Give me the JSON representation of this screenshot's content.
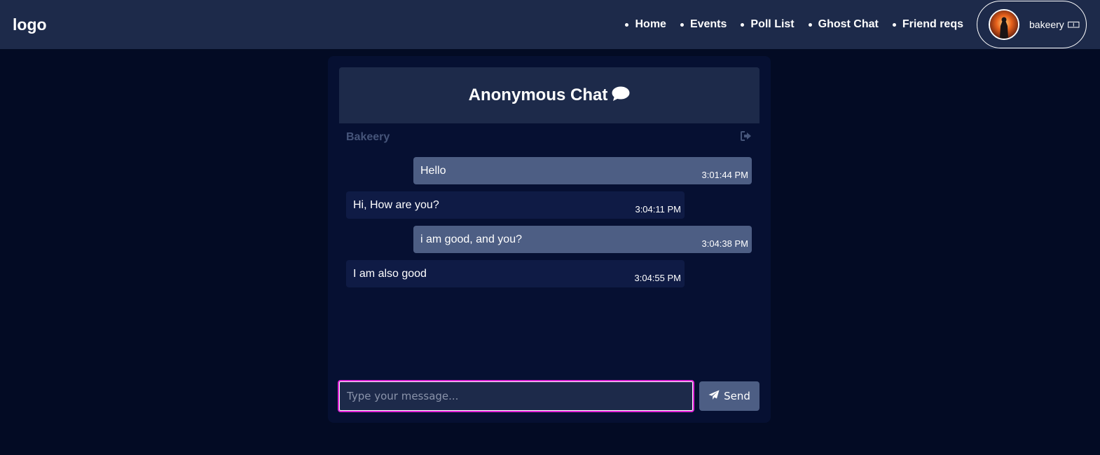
{
  "header": {
    "logo": "logo",
    "nav": [
      {
        "label": "Home"
      },
      {
        "label": "Events"
      },
      {
        "label": "Poll List"
      },
      {
        "label": "Ghost Chat"
      },
      {
        "label": "Friend reqs"
      }
    ],
    "profile": {
      "username": "bakeery 🀱"
    }
  },
  "chat": {
    "title": "Anonymous Chat",
    "peer_name": "Bakeery",
    "messages": [
      {
        "direction": "sent",
        "text": "Hello",
        "time": "3:01:44 PM"
      },
      {
        "direction": "received",
        "text": "Hi, How are you?",
        "time": "3:04:11 PM"
      },
      {
        "direction": "sent",
        "text": "i am good, and you?",
        "time": "3:04:38 PM"
      },
      {
        "direction": "received",
        "text": "I am also good",
        "time": "3:04:55 PM"
      }
    ],
    "input": {
      "value": "",
      "placeholder": "Type your message..."
    },
    "send_label": "Send"
  },
  "icons": {
    "title_icon": "comment-icon",
    "leave_icon": "sign-out-icon",
    "send_icon": "paper-plane-icon"
  },
  "colors": {
    "background": "#030b24",
    "header": "#1d2a4a",
    "sent_bubble": "#4d5e84",
    "received_bubble": "#0f1b45",
    "input_focus_border": "#e024d8"
  }
}
